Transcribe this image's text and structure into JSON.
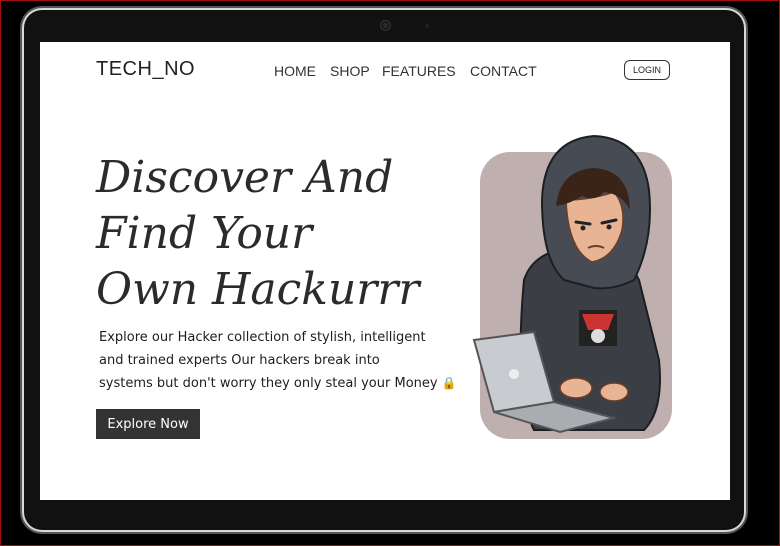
{
  "brand": {
    "logo_text": "TECH_NO"
  },
  "nav": {
    "items": [
      {
        "label": "HOME"
      },
      {
        "label": "SHOP"
      },
      {
        "label": "FEATURES"
      },
      {
        "label": "CONTACT"
      }
    ],
    "login_label": "LOGIN"
  },
  "hero": {
    "headline_lines": [
      "Discover And",
      "Find Your",
      "Own Hackurrr"
    ],
    "description_lines": [
      "Explore our Hacker collection of stylish, intelligent",
      "and trained experts Our hackers break into",
      "systems but don't worry they only steal your Money"
    ],
    "description_emoji": "🔒",
    "cta_label": "Explore Now",
    "image_icon": "hacker-boy-laptop-illustration",
    "image_bg_color": "#c0afaf"
  },
  "device": {
    "type": "tablet",
    "frame_color": "#111111"
  }
}
